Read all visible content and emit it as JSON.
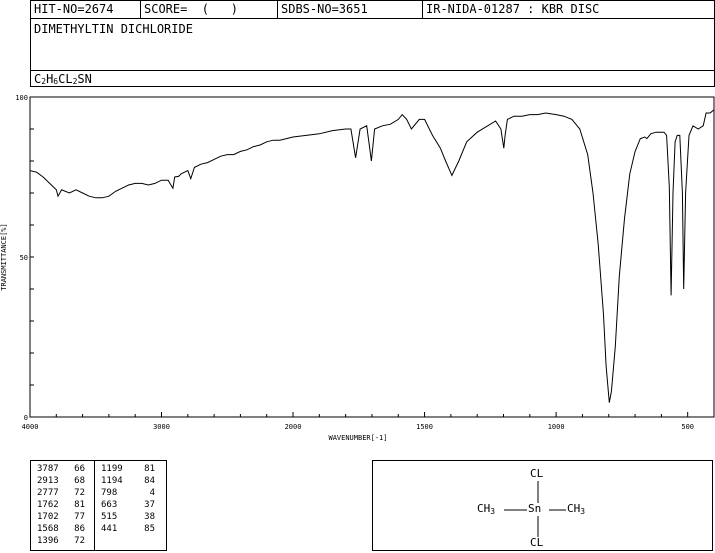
{
  "header": {
    "hit_no": "HIT-NO=2674",
    "score": "SCORE=  (   )",
    "sdbs_no": "SDBS-NO=3651",
    "source": "IR-NIDA-01287 : KBR DISC"
  },
  "compound_name": "DIMETHYLTIN DICHLORIDE",
  "formula_parts": [
    "C",
    "2",
    "H",
    "6",
    "CL",
    "2",
    "SN"
  ],
  "chart_data": {
    "type": "line",
    "xlabel": "WAVENUMBER[-1]",
    "ylabel": "TRANSMITTANCE[%]",
    "xlim": [
      4000,
      400
    ],
    "ylim": [
      0,
      100
    ],
    "x_ticks": [
      "4000",
      "3000",
      "2000",
      "1500",
      "1000",
      "500"
    ],
    "y_ticks": [
      "100",
      "50",
      "0"
    ],
    "series": [
      {
        "x": [
          4000,
          3950,
          3900,
          3850,
          3800,
          3787,
          3760,
          3700,
          3650,
          3600,
          3550,
          3500,
          3450,
          3400,
          3350,
          3300,
          3250,
          3200,
          3150,
          3100,
          3050,
          3000,
          2950,
          2913,
          2900,
          2870,
          2850,
          2800,
          2777,
          2750,
          2700,
          2650,
          2600,
          2550,
          2500,
          2450,
          2400,
          2350,
          2300,
          2250,
          2200,
          2150,
          2100,
          2050,
          2000,
          1950,
          1900,
          1850,
          1800,
          1780,
          1762,
          1745,
          1720,
          1702,
          1690,
          1660,
          1630,
          1600,
          1585,
          1568,
          1550,
          1520,
          1500,
          1470,
          1440,
          1420,
          1396,
          1370,
          1340,
          1300,
          1260,
          1230,
          1210,
          1199,
          1194,
          1185,
          1160,
          1130,
          1100,
          1070,
          1040,
          1000,
          970,
          940,
          910,
          880,
          860,
          840,
          820,
          810,
          798,
          790,
          775,
          760,
          740,
          720,
          700,
          680,
          663,
          655,
          640,
          620,
          600,
          590,
          580,
          570,
          563,
          556,
          548,
          540,
          530,
          520,
          515,
          508,
          495,
          480,
          460,
          441,
          430,
          415,
          400
        ],
        "y": [
          77,
          76.5,
          75,
          73,
          71,
          69,
          71,
          70,
          71,
          70,
          69,
          68.5,
          68.5,
          69,
          70.5,
          71.5,
          72.5,
          73,
          73,
          72.5,
          73,
          74,
          74,
          71.5,
          75,
          75.2,
          76,
          77,
          74.5,
          78,
          79,
          79.5,
          80.5,
          81.5,
          82,
          82,
          83,
          83.5,
          84.5,
          85,
          86,
          86.5,
          86.5,
          87,
          87.5,
          88,
          88.5,
          89.5,
          90,
          90,
          81,
          90,
          91,
          80,
          90,
          91,
          91.5,
          93,
          94.5,
          93,
          90,
          93,
          93,
          88,
          84,
          80,
          75.5,
          80,
          86,
          89,
          91,
          92.5,
          90,
          84,
          88,
          93,
          94,
          94,
          94.5,
          94.5,
          95,
          94.5,
          94,
          93,
          90,
          82,
          70,
          54,
          32,
          16,
          4.5,
          8,
          22,
          44,
          62,
          76,
          83,
          87,
          87.5,
          87,
          88.5,
          89,
          89,
          89,
          88,
          72,
          38,
          70,
          86,
          88,
          88,
          70,
          40,
          70,
          88,
          91,
          90,
          91,
          95,
          95,
          96
        ]
      }
    ]
  },
  "peak_table": {
    "left": [
      [
        "3787",
        "66"
      ],
      [
        "2913",
        "68"
      ],
      [
        "2777",
        "72"
      ],
      [
        "1762",
        "81"
      ],
      [
        "1702",
        "77"
      ],
      [
        "1568",
        "86"
      ],
      [
        "1396",
        "72"
      ]
    ],
    "right": [
      [
        "1199",
        "81"
      ],
      [
        "1194",
        "84"
      ],
      [
        "798",
        "4"
      ],
      [
        "663",
        "37"
      ],
      [
        "515",
        "38"
      ],
      [
        "441",
        "85"
      ]
    ]
  },
  "structure": {
    "top_label": "CL",
    "bottom_label": "CL",
    "center": "Sn",
    "left_group": [
      "CH",
      "3"
    ],
    "right_group": [
      "CH",
      "3"
    ]
  }
}
